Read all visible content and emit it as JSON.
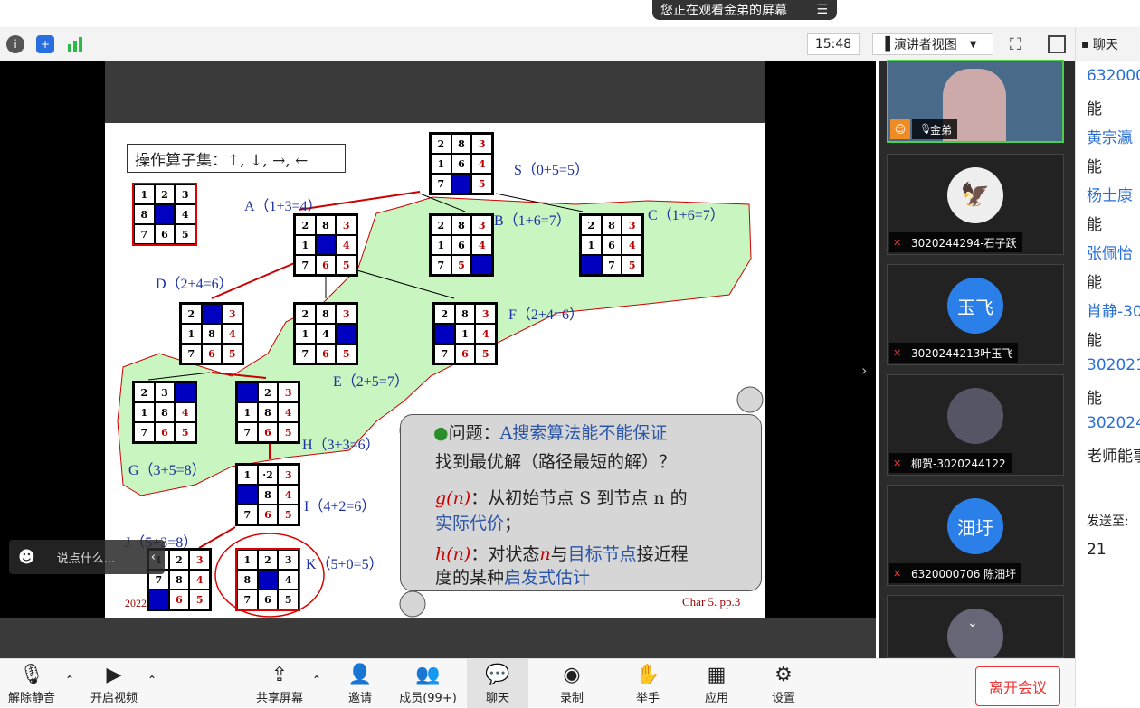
{
  "banner": {
    "text": "您正在观看金弟的屏幕",
    "menu_icon": "menu-icon"
  },
  "toolbar": {
    "time": "15:48",
    "view_label": "演讲者视图",
    "icons": [
      "info-icon",
      "shield-icon",
      "signal-icon",
      "fullscreen-icon",
      "sidebar-toggle-icon"
    ]
  },
  "slide": {
    "operator_set": "操作算子集：↑, ↓, →, ←",
    "labels": {
      "A": "A（1+3=4）",
      "S": "S（0+5=5）",
      "B": "B（1+6=7）",
      "C": "C（1+6=7）",
      "D": "D（2+4=6）",
      "F": "F（2+4=6）",
      "E": "E（2+5=7）",
      "H": "H（3+3=6）",
      "G": "G（3+5=8）",
      "I": "I（4+2=6）",
      "J": "J（5+3=8）",
      "K": "K（5+0=5）"
    },
    "footer": "Char 5. pp.3",
    "year": "2022",
    "q_prefix": "问题：",
    "q_blue": "A搜索算法能不能保证",
    "q_line2": "找到最优解（路径最短的解）？",
    "g_label": "g(n)",
    "g_text": "：从初始节点 S 到节点 n 的",
    "g_blue": "实际代价",
    "g_end": "；",
    "h_label": "h(n)",
    "h_text1": "：对状态",
    "h_n": "n",
    "h_text2": "与",
    "h_blue1": "目标节点",
    "h_text3": "接近程",
    "h_line2a": "度的某种",
    "h_blue2": "启发式估计"
  },
  "puzzles": [
    {
      "id": "goal",
      "cells": [
        "1",
        "2",
        "3",
        "8",
        "",
        "4",
        "7",
        "6",
        "5"
      ]
    },
    {
      "id": "S",
      "cells": [
        "2",
        "8",
        "3",
        "1",
        "6",
        "4",
        "7",
        "",
        "5"
      ]
    },
    {
      "id": "A",
      "cells": [
        "2",
        "8",
        "3",
        "1",
        "",
        "4",
        "7",
        "6",
        "5"
      ]
    },
    {
      "id": "B",
      "cells": [
        "2",
        "8",
        "3",
        "1",
        "6",
        "4",
        "7",
        "5",
        ""
      ]
    },
    {
      "id": "C",
      "cells": [
        "2",
        "8",
        "3",
        "1",
        "6",
        "4",
        "",
        "7",
        "5"
      ]
    },
    {
      "id": "D",
      "cells": [
        "2",
        "",
        "3",
        "1",
        "8",
        "4",
        "7",
        "6",
        "5"
      ]
    },
    {
      "id": "E",
      "cells": [
        "2",
        "8",
        "3",
        "1",
        "4",
        "",
        "7",
        "6",
        "5"
      ]
    },
    {
      "id": "F",
      "cells": [
        "2",
        "8",
        "3",
        "",
        "1",
        "4",
        "7",
        "6",
        "5"
      ]
    },
    {
      "id": "G",
      "cells": [
        "2",
        "3",
        "",
        "1",
        "8",
        "4",
        "7",
        "6",
        "5"
      ]
    },
    {
      "id": "H",
      "cells": [
        "",
        "2",
        "3",
        "1",
        "8",
        "4",
        "7",
        "6",
        "5"
      ]
    },
    {
      "id": "I",
      "cells": [
        "1",
        "·2",
        "3",
        "",
        "8",
        "4",
        "7",
        "6",
        "5"
      ]
    },
    {
      "id": "J",
      "cells": [
        "1",
        "2",
        "3",
        "7",
        "8",
        "4",
        "",
        "6",
        "5"
      ]
    },
    {
      "id": "K",
      "cells": [
        "1",
        "2",
        "3",
        "8",
        "",
        "4",
        "7",
        "6",
        "5"
      ]
    }
  ],
  "comment": {
    "placeholder": "说点什么..."
  },
  "gallery": [
    {
      "name": "金弟",
      "initials": ""
    },
    {
      "name": "3020244294-石子跃",
      "initials": ""
    },
    {
      "name": "3020244213叶玉飞",
      "initials": "玉飞"
    },
    {
      "name": "柳贺-3020244122",
      "initials": ""
    },
    {
      "name": "6320000706 陈沺圩",
      "initials": "沺圩"
    }
  ],
  "chat": {
    "title": "聊天",
    "messages": [
      "632000",
      "能",
      "黄宗瀛",
      "能",
      "杨士康",
      "能",
      "张佩怡",
      "能",
      "肖静-30",
      "能",
      "302021",
      "能",
      "302024",
      "老师能事"
    ],
    "send_to_label": "发送至:",
    "send_to_value": "21"
  },
  "bottom": {
    "mute": "解除静音",
    "video": "开启视频",
    "share": "共享屏幕",
    "invite": "邀请",
    "members": "成员(99+)",
    "chat": "聊天",
    "record": "录制",
    "hand": "举手",
    "apps": "应用",
    "settings": "设置",
    "leave": "离开会议"
  }
}
